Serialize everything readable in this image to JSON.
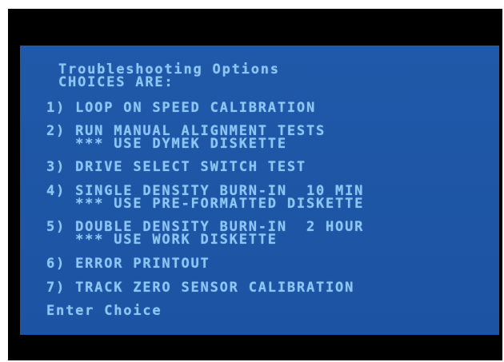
{
  "screen": {
    "title": "Troubleshooting Options",
    "subtitle": "CHOICES ARE:",
    "options": [
      {
        "line1": "1) LOOP ON SPEED CALIBRATION"
      },
      {
        "line1": "2) RUN MANUAL ALIGNMENT TESTS",
        "line2": "   *** USE DYMEK DISKETTE"
      },
      {
        "line1": "3) DRIVE SELECT SWITCH TEST"
      },
      {
        "line1": "4) SINGLE DENSITY BURN-IN  10 MIN",
        "line2": "   *** USE PRE-FORMATTED DISKETTE"
      },
      {
        "line1": "5) DOUBLE DENSITY BURN-IN  2 HOUR",
        "line2": "   *** USE WORK DISKETTE"
      },
      {
        "line1": "6) ERROR PRINTOUT"
      },
      {
        "line1": "7) TRACK ZERO SENSOR CALIBRATION"
      }
    ],
    "prompt": "Enter Choice"
  },
  "colors": {
    "screen_background": "#1f56a8",
    "text": "#8ec6f3",
    "border": "#000000"
  }
}
